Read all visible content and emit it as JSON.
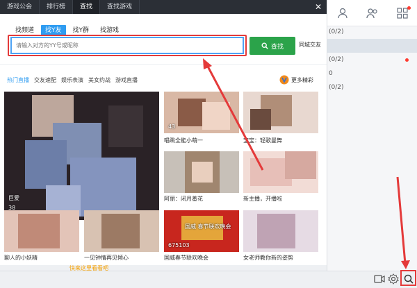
{
  "nav": {
    "tabs": [
      {
        "label": "游戏公会"
      },
      {
        "label": "排行榜"
      },
      {
        "label": "查找"
      },
      {
        "label": "查找游戏"
      }
    ],
    "close": "✕"
  },
  "search": {
    "subtabs": [
      {
        "label": "找频道"
      },
      {
        "label": "找Y友"
      },
      {
        "label": "找Y群"
      },
      {
        "label": "找游戏"
      }
    ],
    "placeholder": "请输入对方的YY号或昵称",
    "button_label": "查找",
    "city_link": "同城交友"
  },
  "categories": [
    {
      "label": "热门直播"
    },
    {
      "label": "交友速配"
    },
    {
      "label": "娱乐表演"
    },
    {
      "label": "美女约战"
    },
    {
      "label": "游戏直播"
    }
  ],
  "more_label": "更多精彩",
  "cards": [
    {
      "caption": "",
      "viewers": "38",
      "overlay": "巨爱"
    },
    {
      "caption": "唱跳全能小萌一",
      "viewers": "43"
    },
    {
      "caption": "宝宝：轻歌曼舞",
      "viewers": "",
      "overlay": ""
    },
    {
      "caption": "阿丽：闭月羞花",
      "viewers": ""
    },
    {
      "caption": "新主播，开播啦",
      "viewers": ""
    },
    {
      "caption": "聊人的小妖精",
      "viewers": ""
    },
    {
      "caption": "一见钟情再见倾心",
      "viewers": ""
    },
    {
      "caption": "国威春节联欢晚会",
      "viewers": "675103",
      "overlay": "国威 春节联欢晚会"
    },
    {
      "caption": "女老师教你新的姿势",
      "viewers": ""
    }
  ],
  "bottom_overlay_text": "快来这里看看吧",
  "right_panel": {
    "rows": [
      {
        "text": "(0/2)"
      },
      {
        "text": ""
      },
      {
        "text": "(0/2)"
      },
      {
        "text": "0"
      },
      {
        "text": "(0/2)"
      }
    ]
  },
  "colors": {
    "accent": "#2f9cf1",
    "find_button": "#2ba34a",
    "highlight_red": "#e43a3a",
    "nav_bg": "#2b2f36"
  }
}
